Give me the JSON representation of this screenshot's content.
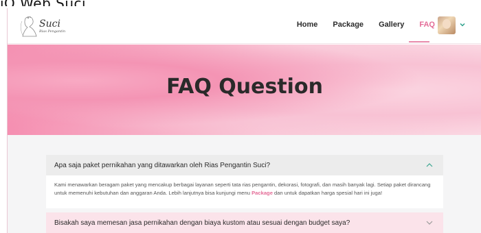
{
  "window": {
    "title": "iQ Web Suci"
  },
  "brand": {
    "logo_text": "Suci",
    "logo_subtext": "Rias Pengantin"
  },
  "nav": {
    "items": [
      "Home",
      "Package",
      "Gallery",
      "FAQ"
    ],
    "active": "FAQ"
  },
  "hero": {
    "title": "FAQ Question"
  },
  "faq": [
    {
      "question": "Apa saja paket pernikahan yang ditawarkan oleh Rias Pengantin Suci?",
      "expanded": true,
      "answer_before_link": "Kami menawarkan beragam paket yang mencakup berbagai layanan seperti tata rias pengantin, dekorasi, fotografi, dan masih banyak lagi. Setiap paket dirancang untuk memenuhi kebutuhan dan anggaran Anda. Lebih lanjutnya bisa kunjungi menu ",
      "answer_link": "Package",
      "answer_after_link": " dan untuk dapatkan harga spesial hari ini juga!"
    },
    {
      "question": "Bisakah saya memesan jasa pernikahan dengan biaya kustom atau sesuai dengan budget saya?",
      "expanded": false
    }
  ],
  "colors": {
    "accent": "#e46c97",
    "hero_pink": "#f58fb1",
    "expanded_header": "#ececec",
    "collapsed_header": "#fbe3ea"
  }
}
